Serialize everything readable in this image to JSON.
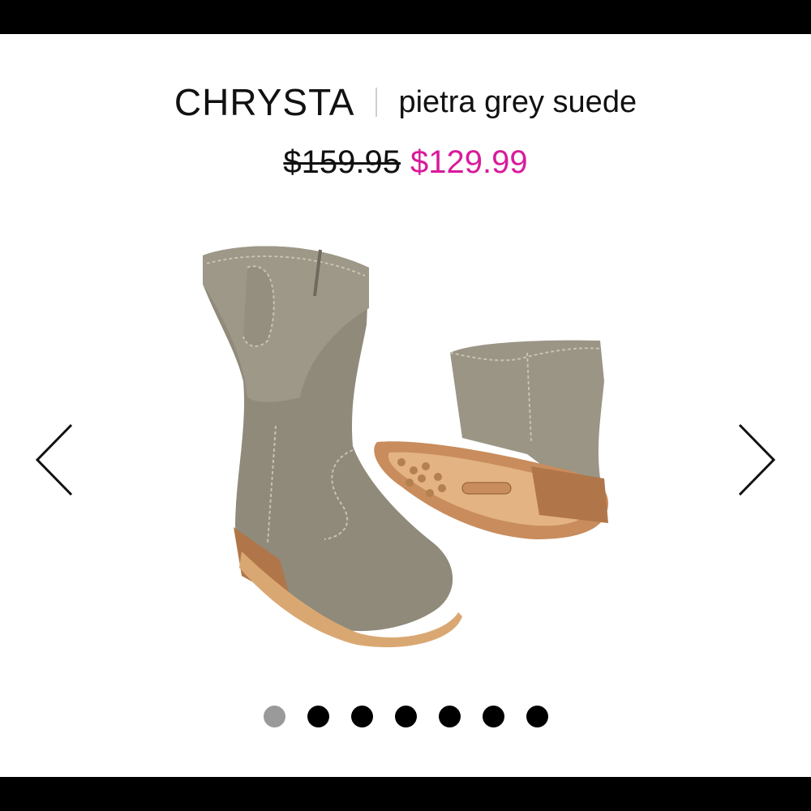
{
  "product": {
    "name": "CHRYSTA",
    "color": "pietra grey suede",
    "price_original": "$159.95",
    "price_sale": "$129.99",
    "sale_color": "#d81b9b"
  },
  "carousel": {
    "prev_icon": "chevron-left-icon",
    "next_icon": "chevron-right-icon",
    "total_images": 7,
    "active_index": 1
  }
}
